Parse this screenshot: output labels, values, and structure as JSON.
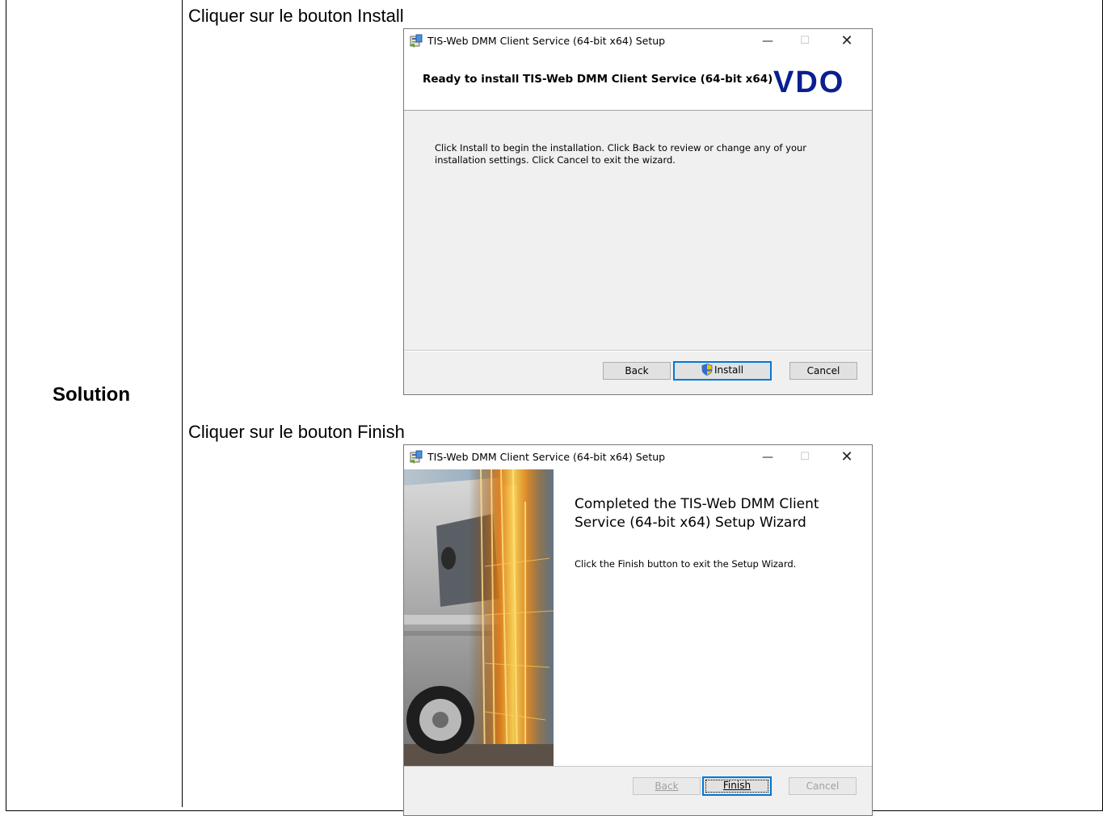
{
  "document": {
    "row_label": "Solution",
    "step1_caption": "Cliquer sur le bouton Install",
    "step2_caption": "Cliquer sur le bouton Finish"
  },
  "window_install": {
    "title": "TIS-Web DMM Client Service (64-bit x64) Setup",
    "heading": "Ready to install TIS-Web DMM Client Service (64-bit x64)",
    "logo_text": "VDO",
    "body_line1": "Click Install to begin the installation. Click Back to review or change any of your",
    "body_line2": "installation settings. Click Cancel to exit the wizard.",
    "buttons": {
      "back": "Back",
      "install": "Install",
      "cancel": "Cancel"
    }
  },
  "window_finish": {
    "title": "TIS-Web DMM Client Service (64-bit x64) Setup",
    "heading": "Completed the TIS-Web DMM Client Service (64-bit x64) Setup Wizard",
    "body": "Click the Finish button to exit the Setup Wizard.",
    "buttons": {
      "back": "Back",
      "finish": "Finish",
      "cancel": "Cancel"
    }
  },
  "titlebar_controls": {
    "minimize": "—",
    "maximize": "☐",
    "close": "✕"
  },
  "colors": {
    "accent": "#0078d7",
    "window_bg": "#f0f0f0",
    "logo": "#0a1f8f"
  }
}
